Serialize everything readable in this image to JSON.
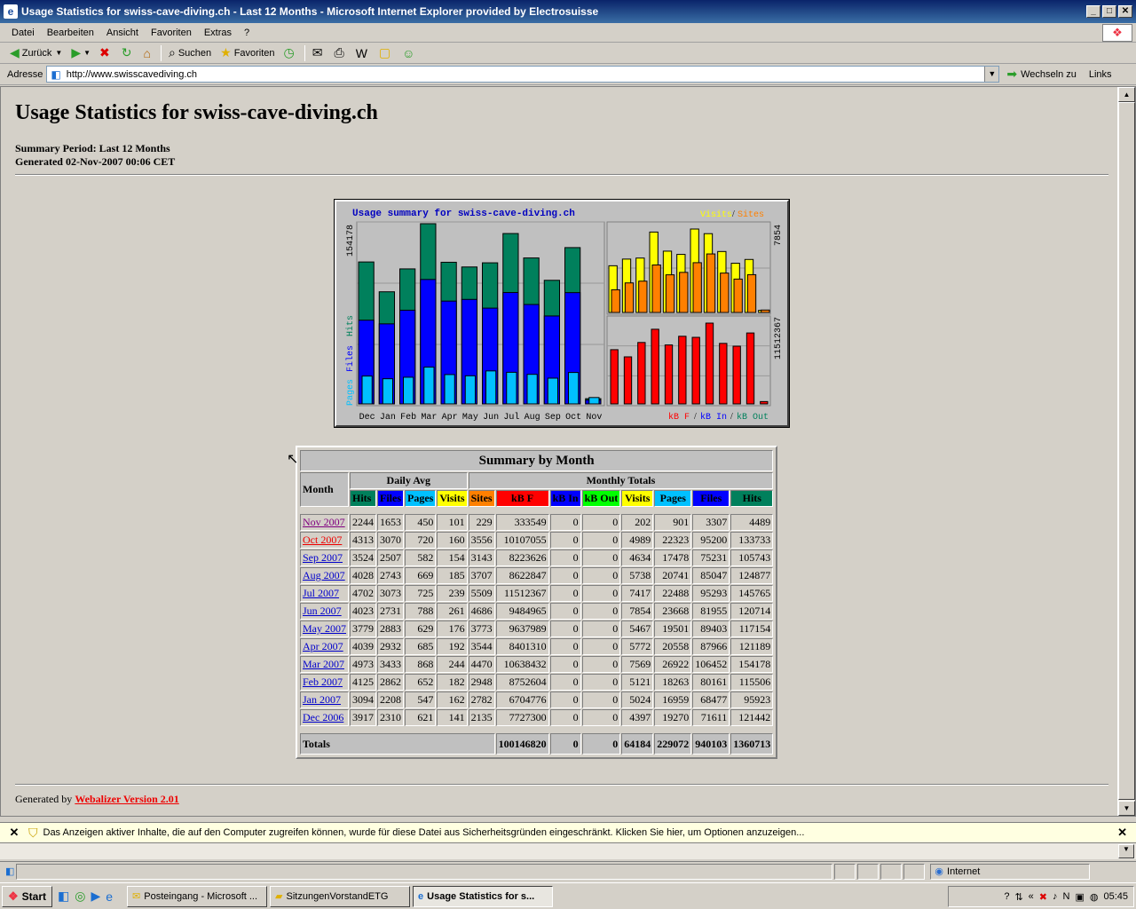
{
  "window": {
    "title": "Usage Statistics for swiss-cave-diving.ch - Last 12 Months - Microsoft Internet Explorer provided by Electrosuisse",
    "min": "_",
    "max": "□",
    "close": "✕"
  },
  "menu": [
    "Datei",
    "Bearbeiten",
    "Ansicht",
    "Favoriten",
    "Extras",
    "?"
  ],
  "toolbar": {
    "back": "Zurück",
    "search": "Suchen",
    "favorites": "Favoriten"
  },
  "address": {
    "label": "Adresse",
    "url": "http://www.swisscavediving.ch",
    "go": "Wechseln zu",
    "links": "Links"
  },
  "page": {
    "title": "Usage Statistics for swiss-cave-diving.ch",
    "period": "Summary Period: Last 12 Months",
    "generated": "Generated 02-Nov-2007 00:06 CET",
    "footer_prefix": "Generated by",
    "footer_link": "Webalizer Version 2.01"
  },
  "chart_data": {
    "type": "bar",
    "title": "Usage summary for swiss-cave-diving.ch",
    "categories": [
      "Dec",
      "Jan",
      "Feb",
      "Mar",
      "Apr",
      "May",
      "Jun",
      "Jul",
      "Aug",
      "Sep",
      "Oct",
      "Nov"
    ],
    "left_max_label": "154178",
    "visits_max_label": "7854",
    "kb_max_label": "11512367",
    "left_axis_label": [
      "Pages",
      "Files",
      "Hits"
    ],
    "right_top_legend": [
      "Visits",
      "Sites"
    ],
    "right_bottom_legend": [
      "kB F",
      "kB In",
      "kB Out"
    ],
    "colors": {
      "hits": "#00805c",
      "files": "#0000ff",
      "pages": "#00c0ff",
      "visits": "#ffff00",
      "sites": "#ff8000",
      "kbf": "#ff0000",
      "kbin": "#0000ff",
      "kbout": "#00805c"
    },
    "series": [
      {
        "name": "Hits",
        "values": [
          121442,
          95923,
          115506,
          154178,
          121189,
          117154,
          120714,
          145765,
          124877,
          105743,
          133733,
          4489
        ]
      },
      {
        "name": "Files",
        "values": [
          71611,
          68477,
          80161,
          106452,
          87966,
          89403,
          81955,
          95293,
          85047,
          75231,
          95200,
          3307
        ]
      },
      {
        "name": "Pages",
        "values": [
          19270,
          16959,
          18263,
          26922,
          20558,
          19501,
          23668,
          22488,
          20741,
          17478,
          22323,
          901
        ]
      },
      {
        "name": "Visits",
        "values": [
          4397,
          5024,
          5121,
          7569,
          5772,
          5467,
          7854,
          7417,
          5738,
          4634,
          4989,
          202
        ]
      },
      {
        "name": "Sites",
        "values": [
          2135,
          2782,
          2948,
          4470,
          3544,
          3773,
          4686,
          5509,
          3707,
          3143,
          3556,
          229
        ]
      },
      {
        "name": "kB F",
        "values": [
          7727300,
          6704776,
          8752604,
          10638432,
          8401310,
          9637989,
          9484965,
          11512367,
          8622847,
          8223626,
          10107055,
          333549
        ]
      }
    ]
  },
  "table": {
    "caption": "Summary by Month",
    "month_header": "Month",
    "daily_avg": "Daily Avg",
    "monthly_totals": "Monthly Totals",
    "col_headers": [
      "Hits",
      "Files",
      "Pages",
      "Visits",
      "Sites",
      "kB F",
      "kB In",
      "kB Out",
      "Visits",
      "Pages",
      "Files",
      "Hits"
    ],
    "col_colors": [
      "#00805c",
      "#0000ff",
      "#00c0ff",
      "#ffff00",
      "#ff8000",
      "#ff0000",
      "#0000ff",
      "#00ff00",
      "#ffff00",
      "#00c0ff",
      "#0000ff",
      "#00805c"
    ],
    "rows": [
      {
        "month": "Nov 2007",
        "vals": [
          "2244",
          "1653",
          "450",
          "101",
          "229",
          "333549",
          "0",
          "0",
          "202",
          "901",
          "3307",
          "4489"
        ]
      },
      {
        "month": "Oct 2007",
        "vals": [
          "4313",
          "3070",
          "720",
          "160",
          "3556",
          "10107055",
          "0",
          "0",
          "4989",
          "22323",
          "95200",
          "133733"
        ]
      },
      {
        "month": "Sep 2007",
        "vals": [
          "3524",
          "2507",
          "582",
          "154",
          "3143",
          "8223626",
          "0",
          "0",
          "4634",
          "17478",
          "75231",
          "105743"
        ]
      },
      {
        "month": "Aug 2007",
        "vals": [
          "4028",
          "2743",
          "669",
          "185",
          "3707",
          "8622847",
          "0",
          "0",
          "5738",
          "20741",
          "85047",
          "124877"
        ]
      },
      {
        "month": "Jul 2007",
        "vals": [
          "4702",
          "3073",
          "725",
          "239",
          "5509",
          "11512367",
          "0",
          "0",
          "7417",
          "22488",
          "95293",
          "145765"
        ]
      },
      {
        "month": "Jun 2007",
        "vals": [
          "4023",
          "2731",
          "788",
          "261",
          "4686",
          "9484965",
          "0",
          "0",
          "7854",
          "23668",
          "81955",
          "120714"
        ]
      },
      {
        "month": "May 2007",
        "vals": [
          "3779",
          "2883",
          "629",
          "176",
          "3773",
          "9637989",
          "0",
          "0",
          "5467",
          "19501",
          "89403",
          "117154"
        ]
      },
      {
        "month": "Apr 2007",
        "vals": [
          "4039",
          "2932",
          "685",
          "192",
          "3544",
          "8401310",
          "0",
          "0",
          "5772",
          "20558",
          "87966",
          "121189"
        ]
      },
      {
        "month": "Mar 2007",
        "vals": [
          "4973",
          "3433",
          "868",
          "244",
          "4470",
          "10638432",
          "0",
          "0",
          "7569",
          "26922",
          "106452",
          "154178"
        ]
      },
      {
        "month": "Feb 2007",
        "vals": [
          "4125",
          "2862",
          "652",
          "182",
          "2948",
          "8752604",
          "0",
          "0",
          "5121",
          "18263",
          "80161",
          "115506"
        ]
      },
      {
        "month": "Jan 2007",
        "vals": [
          "3094",
          "2208",
          "547",
          "162",
          "2782",
          "6704776",
          "0",
          "0",
          "5024",
          "16959",
          "68477",
          "95923"
        ]
      },
      {
        "month": "Dec 2006",
        "vals": [
          "3917",
          "2310",
          "621",
          "141",
          "2135",
          "7727300",
          "0",
          "0",
          "4397",
          "19270",
          "71611",
          "121442"
        ]
      }
    ],
    "totals_label": "Totals",
    "totals": [
      "100146820",
      "0",
      "0",
      "64184",
      "229072",
      "940103",
      "1360713"
    ]
  },
  "infobar": {
    "text": "Das Anzeigen aktiver Inhalte, die auf den Computer zugreifen können, wurde für diese Datei aus Sicherheitsgründen eingeschränkt. Klicken Sie hier, um Optionen anzuzeigen..."
  },
  "status": {
    "zone": "Internet"
  },
  "taskbar": {
    "start": "Start",
    "buttons": [
      "Posteingang - Microsoft ...",
      "SitzungenVorstandETG",
      "Usage Statistics for s..."
    ],
    "clock": "05:45"
  }
}
